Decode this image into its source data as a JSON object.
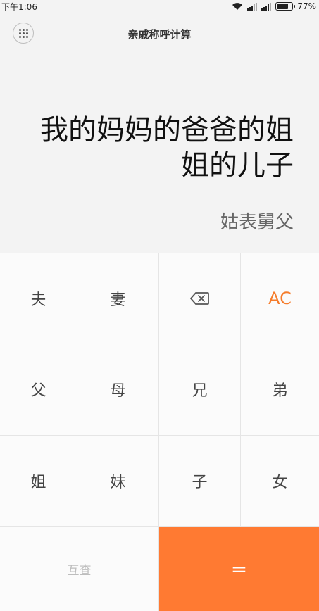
{
  "status_bar": {
    "time": "下午1:06",
    "battery_percent": "77%",
    "battery_level": 0.77
  },
  "header": {
    "title": "亲戚称呼计算",
    "menu_icon": "grid-dots-icon"
  },
  "display": {
    "expression": "我的妈妈的爸爸的姐姐的儿子",
    "result": "姑表舅父"
  },
  "keypad": {
    "keys": [
      {
        "label": "夫",
        "name": "key-husband"
      },
      {
        "label": "妻",
        "name": "key-wife"
      },
      {
        "label": "",
        "name": "key-backspace",
        "icon": "backspace-icon"
      },
      {
        "label": "AC",
        "name": "key-clear"
      },
      {
        "label": "父",
        "name": "key-father"
      },
      {
        "label": "母",
        "name": "key-mother"
      },
      {
        "label": "兄",
        "name": "key-elder-brother"
      },
      {
        "label": "弟",
        "name": "key-younger-brother"
      },
      {
        "label": "姐",
        "name": "key-elder-sister"
      },
      {
        "label": "妹",
        "name": "key-younger-sister"
      },
      {
        "label": "子",
        "name": "key-son"
      },
      {
        "label": "女",
        "name": "key-daughter"
      }
    ],
    "swap_label": "互查",
    "equals_label": "="
  },
  "colors": {
    "accent": "#ff7a32",
    "ac_text": "#f57c2b",
    "background": "#f3f3f3",
    "keypad_bg": "#fbfbfb"
  }
}
